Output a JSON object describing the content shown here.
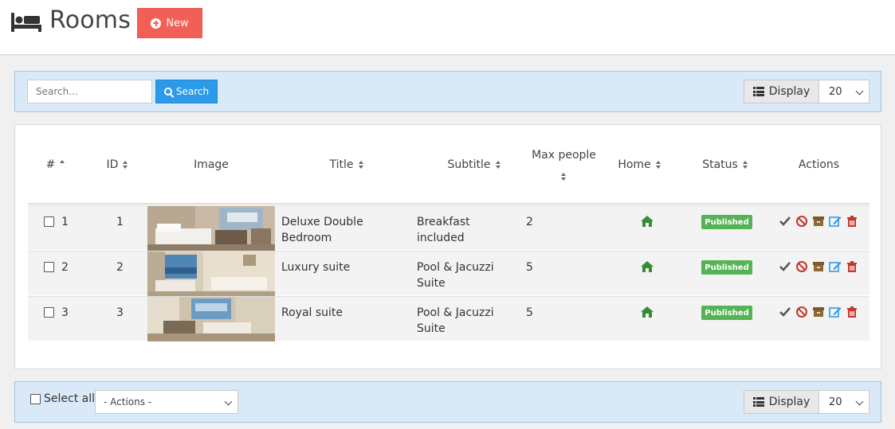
{
  "header": {
    "title": "Rooms",
    "new_label": "New",
    "accent": "#f25f55"
  },
  "search": {
    "placeholder": "Search...",
    "button_label": "Search"
  },
  "display": {
    "label": "Display",
    "per_page": "20"
  },
  "table": {
    "columns": [
      "#",
      "ID",
      "Image",
      "Title",
      "Subtitle",
      "Max people",
      "Home",
      "Status",
      "Actions"
    ],
    "rows": [
      {
        "num": "1",
        "id": "1",
        "title": "Deluxe Double Bedroom",
        "subtitle": "Breakfast included",
        "max_people": "2",
        "status": "Published",
        "image_icon": "bedroom-photo"
      },
      {
        "num": "2",
        "id": "2",
        "title": "Luxury suite",
        "subtitle": "Pool & Jacuzzi Suite",
        "max_people": "5",
        "status": "Published",
        "image_icon": "suite-photo"
      },
      {
        "num": "3",
        "id": "3",
        "title": "Royal suite",
        "subtitle": "Pool & Jacuzzi Suite",
        "max_people": "5",
        "status": "Published",
        "image_icon": "royal-suite-photo"
      }
    ]
  },
  "footer": {
    "select_all_label": "Select all",
    "actions_value": "- Actions -",
    "display_label": "Display",
    "per_page": "20"
  },
  "colors": {
    "status_published": "#55b355",
    "bar_bg": "#d9e9f7",
    "search_button": "#2c9ae8",
    "home_icon": "#3a8a3a"
  }
}
